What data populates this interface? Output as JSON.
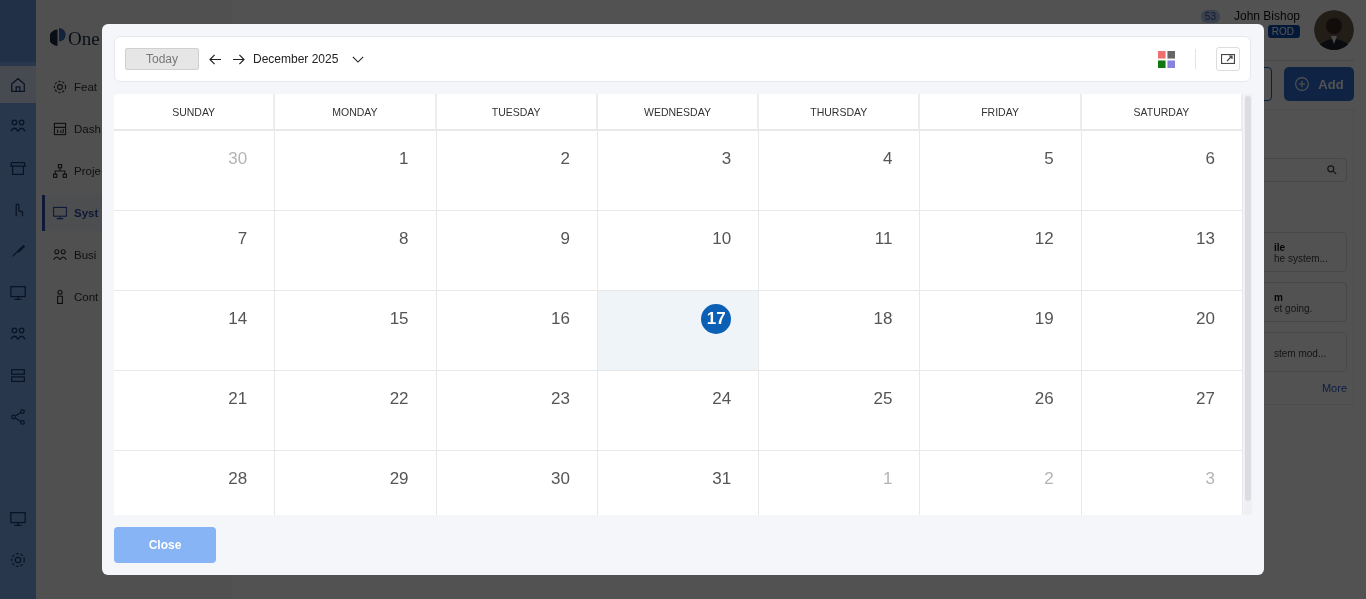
{
  "rail": [
    {
      "selected": true
    },
    {
      "selected": false
    },
    {
      "selected": false
    },
    {
      "selected": false
    },
    {
      "selected": false
    },
    {
      "selected": false
    },
    {
      "selected": false
    },
    {
      "selected": false
    },
    {
      "selected": false
    }
  ],
  "rail_bottom": [
    {
      "selected": false
    },
    {
      "selected": false
    }
  ],
  "logo": {
    "text": "One"
  },
  "nav": [
    {
      "label": "Feat",
      "selected": false
    },
    {
      "label": "Dash",
      "selected": false
    },
    {
      "label": "Proje",
      "selected": false
    },
    {
      "label": "Syst",
      "selected": true
    },
    {
      "label": "Busi",
      "selected": false
    },
    {
      "label": "Cont",
      "selected": false
    }
  ],
  "header": {
    "notifications": "53",
    "user_name": "John Bishop",
    "user_badge": "ROD"
  },
  "actions": {
    "add_label": "Add"
  },
  "cards": [
    {
      "title": "ile",
      "text": "he system..."
    },
    {
      "title": "m",
      "text": "et going."
    },
    {
      "text": "stem mod..."
    }
  ],
  "more_link": "More",
  "modal": {
    "toolbar": {
      "today_label": "Today",
      "month_label": "December 2025"
    },
    "weekdays": [
      "SUNDAY",
      "MONDAY",
      "TUESDAY",
      "WEDNESDAY",
      "THURSDAY",
      "FRIDAY",
      "SATURDAY"
    ],
    "weeks": [
      [
        {
          "label": "30",
          "muted": true,
          "selected": false
        },
        {
          "label": "1",
          "muted": false,
          "selected": false
        },
        {
          "label": "2",
          "muted": false,
          "selected": false
        },
        {
          "label": "3",
          "muted": false,
          "selected": false
        },
        {
          "label": "4",
          "muted": false,
          "selected": false
        },
        {
          "label": "5",
          "muted": false,
          "selected": false
        },
        {
          "label": "6",
          "muted": false,
          "selected": false
        }
      ],
      [
        {
          "label": "7",
          "muted": false,
          "selected": false
        },
        {
          "label": "8",
          "muted": false,
          "selected": false
        },
        {
          "label": "9",
          "muted": false,
          "selected": false
        },
        {
          "label": "10",
          "muted": false,
          "selected": false
        },
        {
          "label": "11",
          "muted": false,
          "selected": false
        },
        {
          "label": "12",
          "muted": false,
          "selected": false
        },
        {
          "label": "13",
          "muted": false,
          "selected": false
        }
      ],
      [
        {
          "label": "14",
          "muted": false,
          "selected": false
        },
        {
          "label": "15",
          "muted": false,
          "selected": false
        },
        {
          "label": "16",
          "muted": false,
          "selected": false
        },
        {
          "label": "17",
          "muted": false,
          "selected": true
        },
        {
          "label": "18",
          "muted": false,
          "selected": false
        },
        {
          "label": "19",
          "muted": false,
          "selected": false
        },
        {
          "label": "20",
          "muted": false,
          "selected": false
        }
      ],
      [
        {
          "label": "21",
          "muted": false,
          "selected": false
        },
        {
          "label": "22",
          "muted": false,
          "selected": false
        },
        {
          "label": "23",
          "muted": false,
          "selected": false
        },
        {
          "label": "24",
          "muted": false,
          "selected": false
        },
        {
          "label": "25",
          "muted": false,
          "selected": false
        },
        {
          "label": "26",
          "muted": false,
          "selected": false
        },
        {
          "label": "27",
          "muted": false,
          "selected": false
        }
      ],
      [
        {
          "label": "28",
          "muted": false,
          "selected": false
        },
        {
          "label": "29",
          "muted": false,
          "selected": false
        },
        {
          "label": "30",
          "muted": false,
          "selected": false
        },
        {
          "label": "31",
          "muted": false,
          "selected": false
        },
        {
          "label": "1",
          "muted": true,
          "selected": false
        },
        {
          "label": "2",
          "muted": true,
          "selected": false
        },
        {
          "label": "3",
          "muted": true,
          "selected": false
        }
      ]
    ],
    "close_label": "Close"
  }
}
